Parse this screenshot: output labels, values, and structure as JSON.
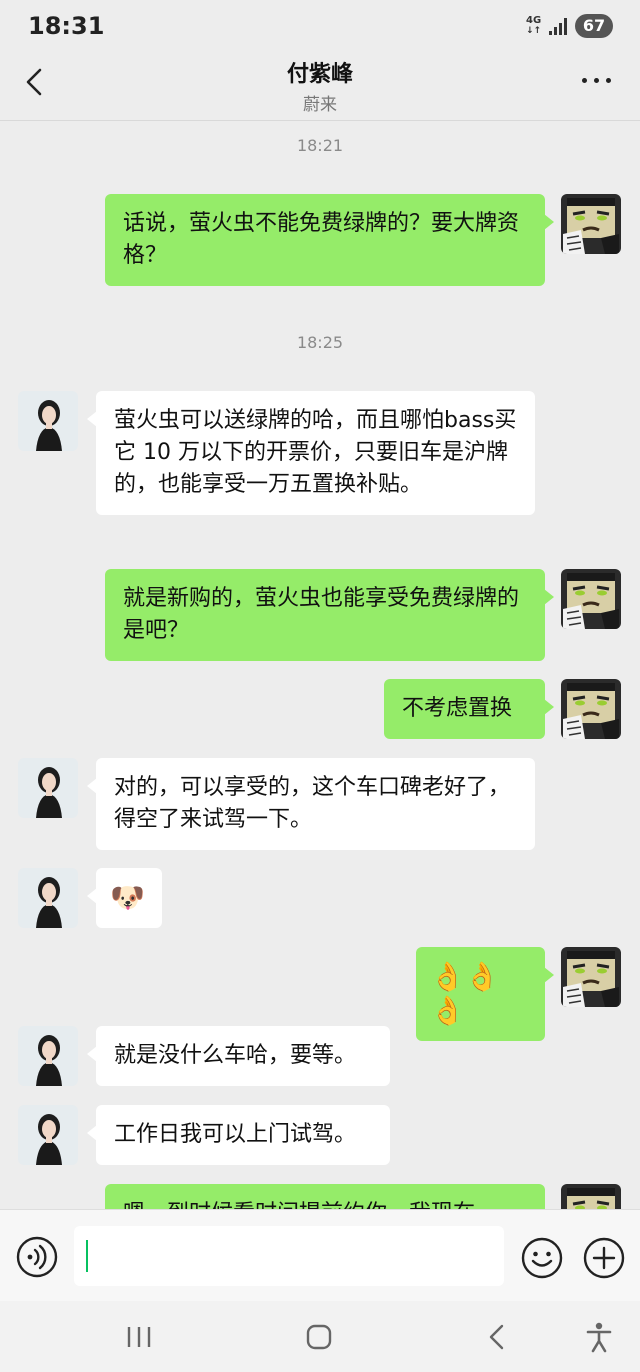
{
  "status_bar": {
    "time": "18:31",
    "network": "4G",
    "battery": "67"
  },
  "header": {
    "title": "付紫峰",
    "subtitle": "蔚来"
  },
  "chat": {
    "timestamps": [
      "18:21",
      "18:25"
    ],
    "messages": [
      {
        "from": "me",
        "text": "话说，萤火虫不能免费绿牌的？要大牌资格？"
      },
      {
        "from": "them",
        "text": "萤火虫可以送绿牌的哈，而且哪怕bass买它 10 万以下的开票价，只要旧车是沪牌的，也能享受一万五置换补贴。"
      },
      {
        "from": "me",
        "text": "就是新购的，萤火虫也能享受免费绿牌的是吧？"
      },
      {
        "from": "me",
        "text": "不考虑置换"
      },
      {
        "from": "them",
        "text": "对的，可以享受的，这个车口碑老好了，得空了来试驾一下。"
      },
      {
        "from": "them",
        "text": "🐶"
      },
      {
        "from": "me",
        "text": "👌👌👌"
      },
      {
        "from": "them",
        "text": "就是没什么车哈，要等。"
      },
      {
        "from": "them",
        "text": "工作日我可以上门试驾。"
      },
      {
        "from": "me",
        "text": "嗯，到时候看时间提前约你，我现在"
      }
    ]
  },
  "input": {
    "value": ""
  },
  "icons": {
    "back": "chevron-left-icon",
    "more": "more-dots-icon",
    "voice": "voice-icon",
    "emoji": "emoji-icon",
    "plus": "plus-icon"
  },
  "colors": {
    "my_bubble": "#95ec69",
    "their_bubble": "#ffffff",
    "background": "#ededed",
    "caret": "#07c160"
  }
}
